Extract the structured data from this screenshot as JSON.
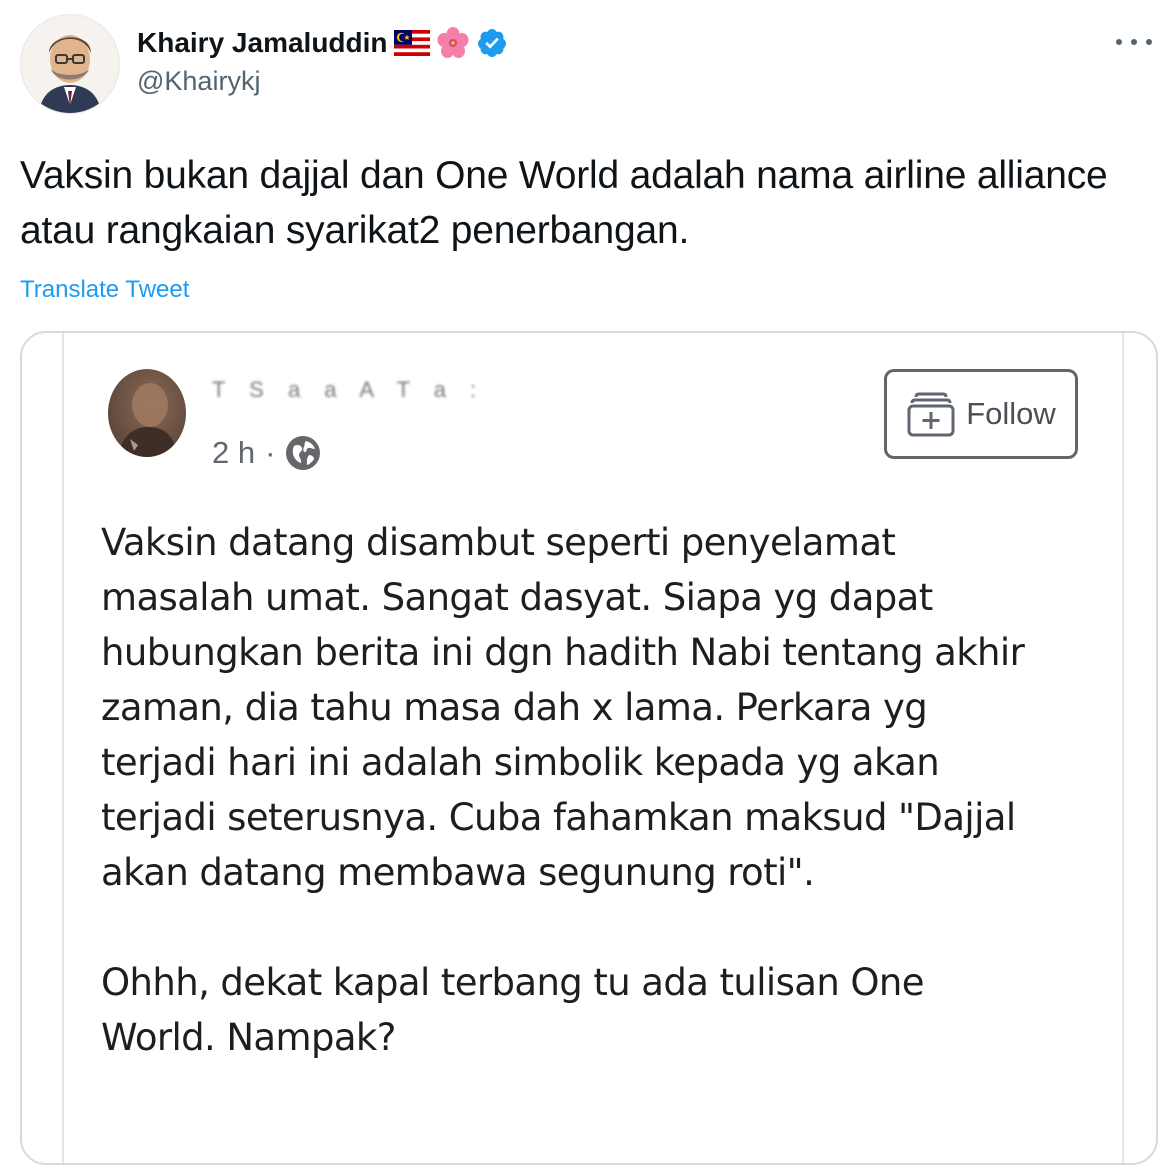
{
  "tweet": {
    "author": {
      "display_name": "Khairy Jamaluddin",
      "handle": "@Khairykj",
      "badges": [
        "malaysia-flag-icon",
        "hibiscus-icon",
        "verified-icon"
      ]
    },
    "text": "Vaksin bukan dajjal dan One World adalah nama airline alliance atau rangkaian syarikat2 penerbangan.",
    "translate_label": "Translate Tweet",
    "more_icon": "more-icon"
  },
  "embedded_post": {
    "author_name_obscured": "T    S  a  a  A  T  a  :",
    "time": "2 h",
    "separator": "·",
    "privacy_icon": "globe-icon",
    "follow_label": "Follow",
    "paragraphs": [
      "Vaksin datang disambut seperti penyelamat\nmasalah umat. Sangat dasyat. Siapa yg dapat\nhubungkan berita ini dgn hadith Nabi tentang akhir\nzaman, dia tahu masa dah x lama. Perkara yg\nterjadi hari ini adalah simbolik kepada yg akan\nterjadi seterusnya. Cuba fahamkan maksud \"Dajjal\nakan datang membawa segunung roti\".",
      "Ohhh, dekat kapal terbang tu ada tulisan One\nWorld. Nampak?"
    ]
  },
  "colors": {
    "text_primary": "#0f1419",
    "text_secondary": "#536471",
    "link": "#1d9bf0",
    "verified": "#1d9bf0"
  }
}
